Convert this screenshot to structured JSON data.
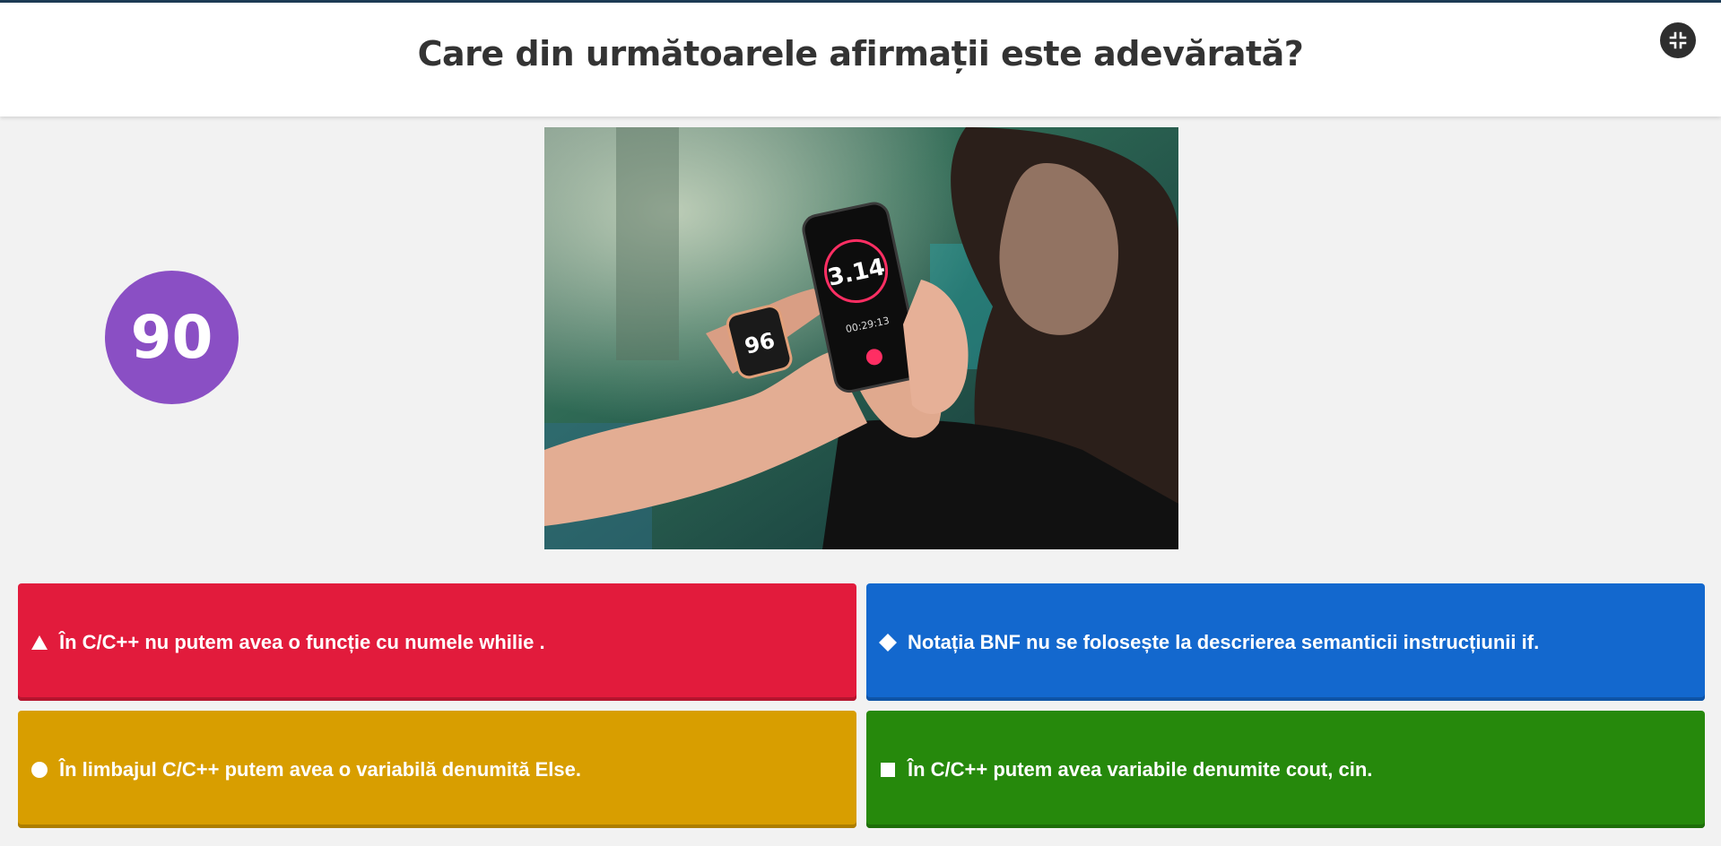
{
  "header": {
    "question": "Care din următoarele afirmații este adevărată?",
    "fullscreen_icon": "fullscreen-exit-icon"
  },
  "timer": {
    "value": "90",
    "color": "#8a4fc4"
  },
  "media": {
    "phone_display": "3.14",
    "phone_time": "00:29:13",
    "watch_display": "96"
  },
  "answers": [
    {
      "shape": "triangle-icon",
      "text": "În C/C++ nu putem avea o funcție cu numele whilie .",
      "color": "#e21b3c"
    },
    {
      "shape": "diamond-icon",
      "text": "Notația BNF nu se folosește la descrierea semanticii instrucțiunii if.",
      "color": "#1368ce"
    },
    {
      "shape": "circle-icon",
      "text": "În limbajul C/C++ putem avea o variabilă denumită Else.",
      "color": "#d89e00"
    },
    {
      "shape": "square-icon",
      "text": "În C/C++ putem avea variabile denumite cout, cin.",
      "color": "#26890c"
    }
  ]
}
